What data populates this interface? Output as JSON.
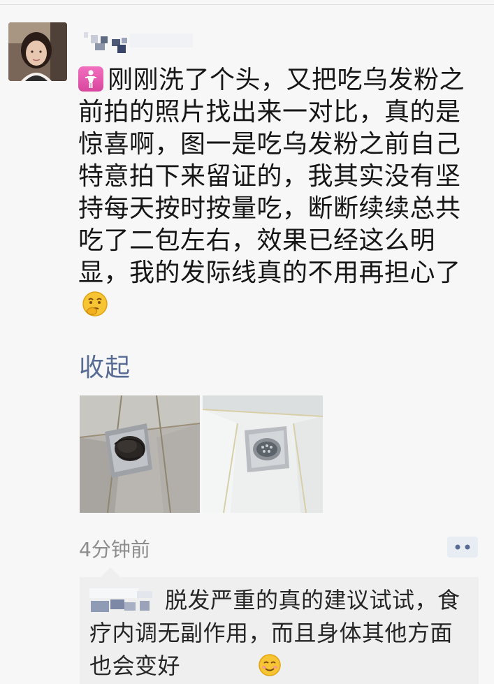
{
  "moment": {
    "post_text": "刚刚洗了个头，又把吃乌发粉之前拍的照片找出来一对比，真的是惊喜啊，图一是吃乌发粉之前自己特意拍下来留证的，我其实没有坚持每天按时按量吃，断断续续总共吃了二包左右，效果已经这么明显，我的发际线真的不用再担心了",
    "collapse_label": "收起",
    "time": "4分钟前"
  },
  "comment": {
    "text": "脱发严重的真的建议试试，食疗内调无副作用，而且身体其他方面也会变好"
  },
  "icons": {
    "badge": "female-symbol-icon",
    "post_emoji": "thinking-face-icon",
    "comment_emoji": "smiling-face-icon",
    "more": "more-dots-icon"
  },
  "colors": {
    "link": "#576b95",
    "badge": "#e056ad"
  }
}
